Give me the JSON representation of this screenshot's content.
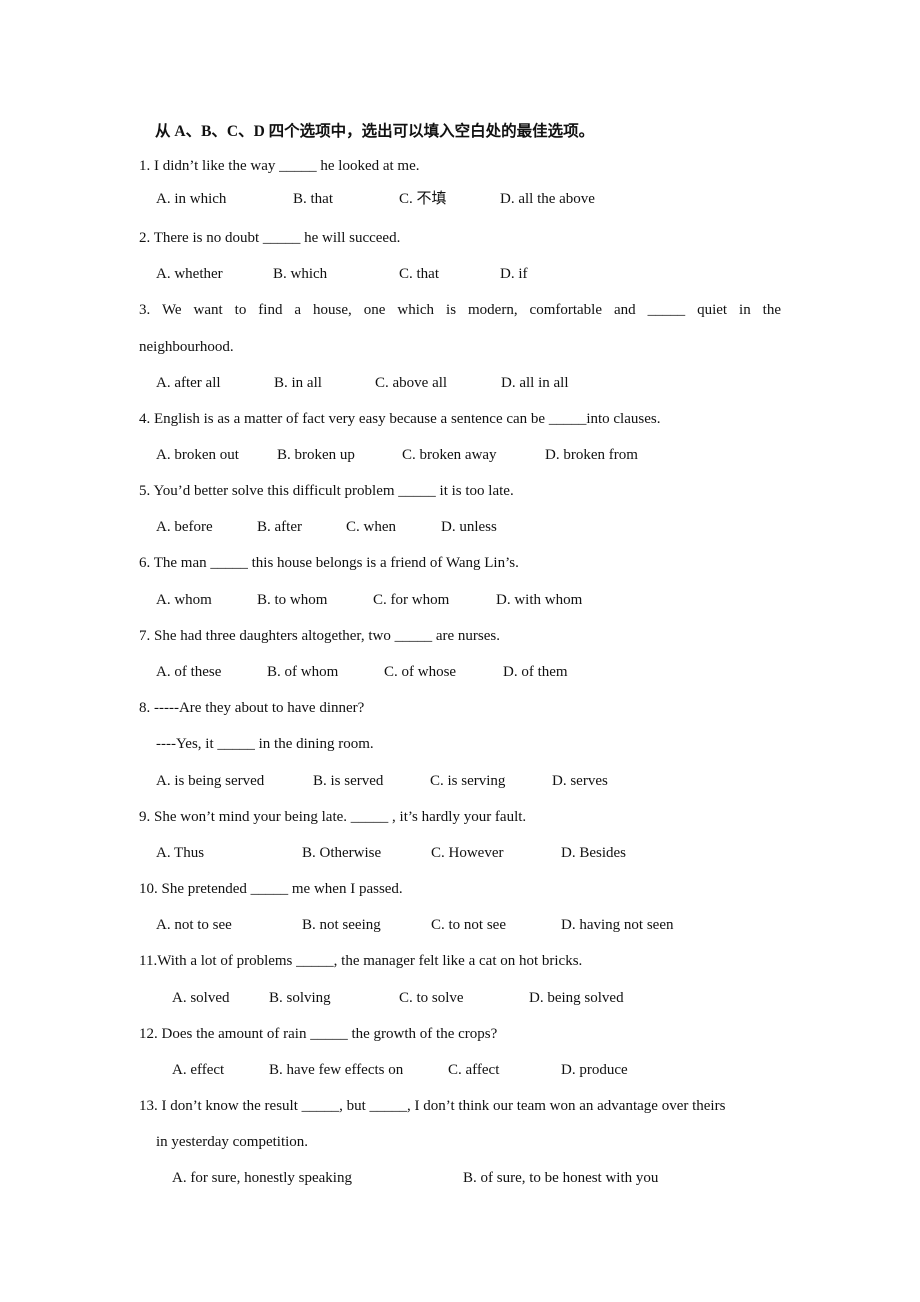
{
  "instruction": "从 A、B、C、D 四个选项中，选出可以填入空白处的最佳选项。",
  "questions": [
    {
      "n": "1",
      "text": "1. I didn’t like the way  _____  he looked at me.",
      "options": [
        "A. in which",
        "B. that",
        "C.  不填",
        "D. all the above"
      ]
    },
    {
      "n": "2",
      "text": "2. There is no doubt  _____  he will succeed.",
      "options": [
        "A. whether",
        "B. which",
        "C. that",
        "D. if"
      ]
    },
    {
      "n": "3",
      "text": "3. We want to find a house, one which is modern, comfortable and _____ quiet in the",
      "text_cont": "neighbourhood.",
      "options": [
        "A. after all",
        "B. in all",
        "C. above all",
        "D. all in all"
      ]
    },
    {
      "n": "4",
      "text": "4. English is as a matter of fact very easy because a sentence can be _____into clauses.",
      "options": [
        "A. broken out",
        "B. broken up",
        "C. broken away",
        "D. broken from"
      ]
    },
    {
      "n": "5",
      "text": "5. You’d better solve this difficult problem _____ it is too late.",
      "options": [
        "A. before",
        "B. after",
        "C. when",
        "D. unless"
      ]
    },
    {
      "n": "6",
      "text": "6. The man _____ this house belongs is a friend of Wang Lin’s.",
      "options": [
        "A. whom",
        "B. to whom",
        "C. for whom",
        "D. with whom"
      ]
    },
    {
      "n": "7",
      "text": "7. She had three daughters altogether, two _____ are nurses.",
      "options": [
        "A. of these",
        "B. of whom",
        "C. of whose",
        "D. of them"
      ]
    },
    {
      "n": "8",
      "text": "8. -----Are they about to have dinner?",
      "text_cont": "----Yes, it _____ in the dining room.",
      "options": [
        "A. is being served",
        "B. is served",
        "C. is serving",
        "D. serves"
      ]
    },
    {
      "n": "9",
      "text": "9. She won’t mind your being late.  _____  , it’s hardly your fault.",
      "options": [
        "A. Thus",
        "B. Otherwise",
        "C. However",
        "D. Besides"
      ]
    },
    {
      "n": "10",
      "text": "10. She pretended  _____  me when I passed.",
      "options": [
        "A. not to see",
        "B. not seeing",
        "C. to not see",
        "D. having not seen"
      ]
    },
    {
      "n": "11",
      "text": "11.With a lot of problems _____, the manager felt like a cat on hot bricks.",
      "options": [
        "A. solved",
        "B. solving",
        "C. to solve",
        "D. being solved"
      ]
    },
    {
      "n": "12",
      "text": "12. Does the amount of rain _____ the growth of the crops?",
      "options": [
        "A. effect",
        "B. have few effects on",
        "C. affect",
        "D. produce"
      ]
    },
    {
      "n": "13",
      "text": "13. I don’t know the result _____, but _____, I don’t think our team won an advantage over theirs",
      "text_cont": "in yesterday competition.",
      "options": [
        "A. for sure, honestly speaking",
        "B. of sure, to be honest with you"
      ]
    }
  ]
}
